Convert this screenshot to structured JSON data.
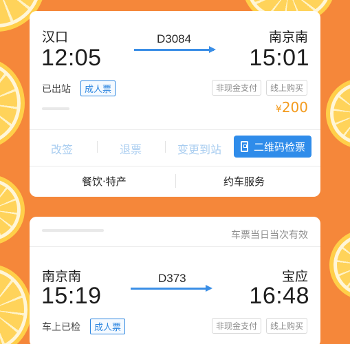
{
  "ticket1": {
    "from_city": "汉口",
    "to_city": "南京南",
    "depart_time": "12:05",
    "arrive_time": "15:01",
    "train_no": "D3084",
    "status": "已出站",
    "ticket_type": "成人票",
    "tags": [
      "非现金支付",
      "线上购买"
    ],
    "price_symbol": "¥",
    "price": "200",
    "actions": [
      "改签",
      "退票",
      "变更到站"
    ],
    "qr_button": "二维码检票",
    "services": [
      "餐饮·特产",
      "约车服务"
    ]
  },
  "ticket2": {
    "validity_note": "车票当日当次有效",
    "from_city": "南京南",
    "to_city": "宝应",
    "depart_time": "15:19",
    "arrive_time": "16:48",
    "train_no": "D373",
    "status": "车上已检",
    "ticket_type": "成人票",
    "tags": [
      "非现金支付",
      "线上购买"
    ]
  },
  "colors": {
    "accent": "#2f8cea",
    "price": "#f39a1c",
    "background": "#f5873a"
  }
}
